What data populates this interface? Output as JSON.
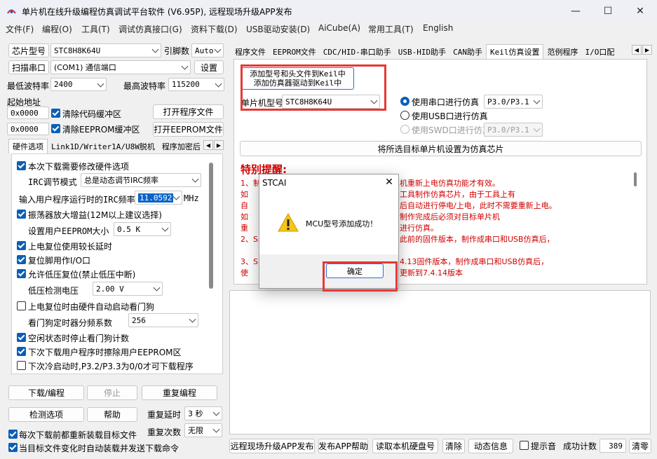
{
  "window": {
    "title": "单片机在线升级编程仿真调试平台软件 (V6.95P), 远程现场升级APP发布",
    "minimize": "—",
    "maximize": "☐",
    "close": "✕"
  },
  "menu": [
    "文件(F)",
    "编程(O)",
    "工具(T)",
    "调试仿真接口(G)",
    "资料下载(D)",
    "USB驱动安装(D)",
    "AiCube(A)",
    "常用工具(T)",
    "English"
  ],
  "left": {
    "chip_label": "芯片型号",
    "chip_value": "STC8H8K64U",
    "pin_label": "引脚数",
    "pin_value": "Auto",
    "scan_button": "扫描串口",
    "port_value": "(COM1) 通信端口",
    "settings_button": "设置",
    "min_baud_label": "最低波特率",
    "min_baud_value": "2400",
    "max_baud_label": "最高波特率",
    "max_baud_value": "115200",
    "start_addr_label": "起始地址",
    "addr1": "0x0000",
    "clear_code": "清除代码缓冲区",
    "open_program": "打开程序文件",
    "addr2": "0x0000",
    "clear_eeprom": "清除EEPROM缓冲区",
    "open_eeprom": "打开EEPROM文件",
    "tabs": [
      "硬件选项",
      "Link1D/Writer1A/U8W脱机",
      "程序加密后"
    ]
  },
  "hw": {
    "opt1": "本次下载需要修改硬件选项",
    "irc_mode_label": "IRC调节模式",
    "irc_mode_value": "总是动态调节IRC频率",
    "irc_freq_label": "输入用户程序运行时的IRC频率",
    "irc_freq_value": "11.0592",
    "irc_unit": "MHz",
    "opt2": "振荡器放大增益(12M以上建议选择)",
    "eeprom_size_label": "设置用户EEPROM大小",
    "eeprom_size_value": "0.5 K",
    "opt3": "上电复位使用较长延时",
    "opt4": "复位脚用作I/O口",
    "opt5": "允许低压复位(禁止低压中断)",
    "lvd_label": "低压检测电压",
    "lvd_value": "2.00 V",
    "opt6": "上电复位时由硬件自动启动看门狗",
    "wdt_label": "看门狗定时器分频系数",
    "wdt_value": "256",
    "opt7": "空闲状态时停止看门狗计数",
    "opt8": "下次下载用户程序时擦除用户EEPROM区",
    "opt9": "下次冷启动时,P3.2/P3.3为0/0才可下载程序"
  },
  "bottom_left": {
    "download": "下载/编程",
    "stop": "停止",
    "reprogram": "重复编程",
    "check": "检测选项",
    "help": "帮助",
    "repeat_delay_label": "重复延时",
    "repeat_delay_value": "3 秒",
    "repeat_count_label": "重复次数",
    "repeat_count_value": "无限",
    "reload": "每次下载前都重新装载目标文件",
    "auto_send": "当目标文件变化时自动装载并发送下载命令"
  },
  "right": {
    "tabs": [
      "程序文件",
      "EEPROM文件",
      "CDC/HID-串口助手",
      "USB-HID助手",
      "CAN助手",
      "Keil仿真设置",
      "范例程序",
      "I/O口配"
    ],
    "add_btn1": "添加型号和头文件到Keil中",
    "add_btn2": "添加仿真器驱动到Keil中",
    "mcu_label": "单片机型号",
    "mcu_value": "STC8H8K64U",
    "radio1": "使用串口进行仿真",
    "radio1_val": "P3.0/P3.1",
    "radio2": "使用USB口进行仿真",
    "radio3": "使用SWD口进行仿真",
    "radio3_val": "P3.0/P3.1",
    "set_chip": "将所选目标单片机设置为仿真芯片",
    "notice_title": "特别提醒:",
    "notice": [
      "1、制",
      "    如",
      "    自",
      "    如",
      "    重",
      "2、S",
      "3、S",
      "    使"
    ],
    "notice_right": [
      "机重新上电仿真功能才有效。",
      "工具制作仿真芯片，由于工具上有",
      "后自动进行停电/上电，此时不需要重新上电。",
      "制作完成后必须对目标单片机",
      "进行仿真。",
      "此前的固件版本，制作成串口和USB仿真后，",
      "4.13固件版本，制作成串口和USB仿真后，",
      "更新到7.4.14版本"
    ]
  },
  "status": {
    "publish": "远程现场升级APP发布",
    "publish_help": "发布APP帮助",
    "read_disk": "读取本机硬盘号",
    "clear": "清除",
    "dynamic": "动态信息",
    "beep": "提示音",
    "count_label": "成功计数",
    "count_value": "389",
    "reset": "清零"
  },
  "dialog": {
    "title": "STCAI",
    "message": "MCU型号添加成功！",
    "ok": "确定"
  }
}
